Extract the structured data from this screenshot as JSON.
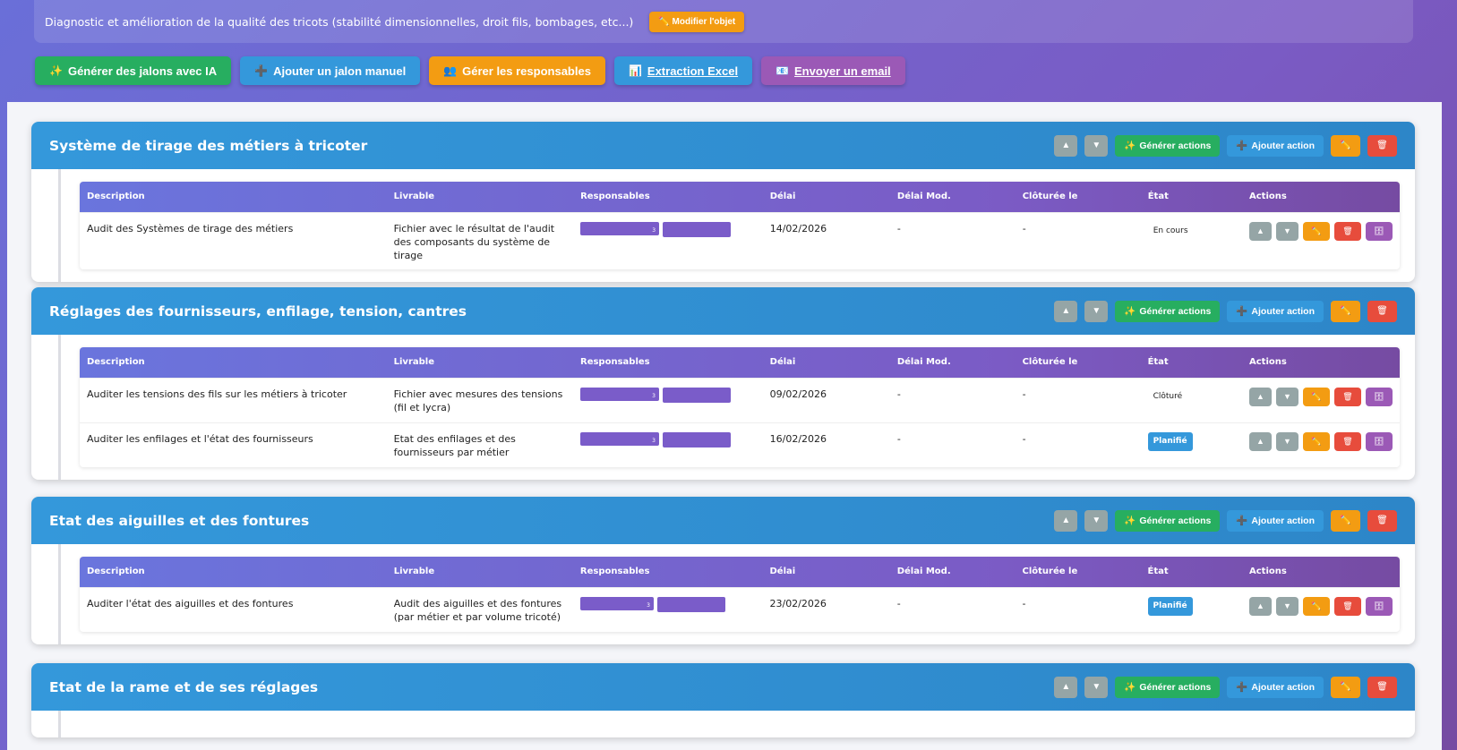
{
  "objective": {
    "text": "Diagnostic et amélioration de la qualité des tricots (stabilité dimensionnelles, droit fils, bombages, etc...)",
    "edit_label": "✏️ Modifier l'objet"
  },
  "main_actions": {
    "generate_ai": "Générer des jalons avec IA",
    "add_manual": "Ajouter un jalon manuel",
    "manage_resp": "Gérer les responsables",
    "extract_excel": "Extraction Excel",
    "send_email": "Envoyer un email"
  },
  "icons": {
    "sparkle": "✨",
    "plus": "➕",
    "people": "👥",
    "chart": "📊",
    "email": "📧",
    "up": "▲",
    "down": "▼",
    "pencil": "✏️",
    "trash": "🗑",
    "archive": "🗄"
  },
  "milestone_controls": {
    "generate_actions": "Générer actions",
    "add_action": "Ajouter action"
  },
  "table_headers": {
    "description": "Description",
    "livrable": "Livrable",
    "responsables": "Responsables",
    "delai": "Délai",
    "delai_mod": "Délai Mod.",
    "cloturee": "Clôturée le",
    "etat": "État",
    "actions": "Actions"
  },
  "milestones": [
    {
      "title": "Système de tirage des métiers à tricoter",
      "rows": [
        {
          "description": "Audit des Systèmes de tirage des métiers",
          "livrable": "Fichier avec le résultat de l'audit des composants du système de tirage",
          "resp_count": "3",
          "delai": "14/02/2026",
          "delai_mod": "-",
          "cloturee": "-",
          "etat": "En cours"
        }
      ]
    },
    {
      "title": "Réglages des fournisseurs, enfilage, tension, cantres",
      "rows": [
        {
          "description": "Auditer les tensions des fils sur les métiers à tricoter",
          "livrable": "Fichier avec mesures des tensions (fil et lycra)",
          "resp_count": "3",
          "delai": "09/02/2026",
          "delai_mod": "-",
          "cloturee": "-",
          "etat": "Clôturé"
        },
        {
          "description": "Auditer les enfilages et l'état des fournisseurs",
          "livrable": "Etat des enfilages et des fournisseurs par métier",
          "resp_count": "3",
          "delai": "16/02/2026",
          "delai_mod": "-",
          "cloturee": "-",
          "etat": "Planifié"
        }
      ]
    },
    {
      "title": "Etat des aiguilles et des fontures",
      "rows": [
        {
          "description": "Auditer l'état des aiguilles et des fontures",
          "livrable": "Audit des aiguilles et des fontures (par métier et par volume tricoté)",
          "resp_count": "3",
          "delai": "23/02/2026",
          "delai_mod": "-",
          "cloturee": "-",
          "etat": "Planifié"
        }
      ]
    },
    {
      "title": "Etat de la rame et de ses réglages",
      "rows": []
    }
  ],
  "colors": {
    "primary_blue": "#3498db",
    "green": "#27ae60",
    "orange": "#f39c12",
    "purple": "#9b59b6",
    "red": "#e74c3c",
    "grey": "#95a5a6"
  }
}
